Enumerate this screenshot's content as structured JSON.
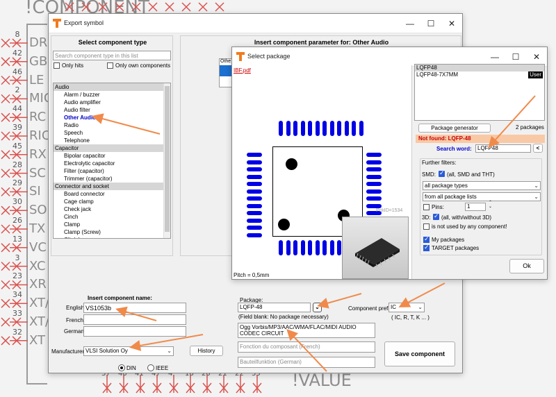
{
  "schematic": {
    "component_label": "!COMPONENT",
    "value_label": "!VALUE",
    "pins": [
      {
        "num": "8",
        "name": "DR"
      },
      {
        "num": "42",
        "name": "GB"
      },
      {
        "num": "46",
        "name": "LE"
      },
      {
        "num": "2",
        "name": "MIC"
      },
      {
        "num": "44",
        "name": "RC"
      },
      {
        "num": "39",
        "name": "RIC"
      },
      {
        "num": "45",
        "name": "RX"
      },
      {
        "num": "28",
        "name": "SC"
      },
      {
        "num": "29",
        "name": "SI"
      },
      {
        "num": "30",
        "name": "SO"
      },
      {
        "num": "26",
        "name": "TX"
      },
      {
        "num": "13",
        "name": "VC"
      },
      {
        "num": "3",
        "name": "XC"
      },
      {
        "num": "23",
        "name": "XR"
      },
      {
        "num": "34",
        "name": "XT/"
      },
      {
        "num": "33",
        "name": "XT/"
      },
      {
        "num": "32",
        "name": "XT"
      }
    ],
    "bottom_pins": [
      "37",
      "40",
      "41",
      "47",
      "4",
      "16",
      "20",
      "21",
      "22",
      "35"
    ]
  },
  "export_window": {
    "title": "Export symbol",
    "select_type_heading": "Select component type",
    "search_placeholder": "Search component type in this list",
    "only_hits_label": "Only hits",
    "only_own_label": "Only own components",
    "insert_param_heading": "Insert component parameter for: Other Audio",
    "param_stub": "Othe",
    "types_list": [
      {
        "label": "Audio",
        "kind": "cat"
      },
      {
        "label": "Alarm / buzzer",
        "kind": "item"
      },
      {
        "label": "Audio amplifier",
        "kind": "item"
      },
      {
        "label": "Audio filter",
        "kind": "item"
      },
      {
        "label": "Other Audio",
        "kind": "sel"
      },
      {
        "label": "Radio",
        "kind": "item"
      },
      {
        "label": "Speech",
        "kind": "item"
      },
      {
        "label": "Telephone",
        "kind": "item"
      },
      {
        "label": "Capacitor",
        "kind": "cat"
      },
      {
        "label": "Bipolar capacitor",
        "kind": "item"
      },
      {
        "label": "Electrolytic capacitor",
        "kind": "item"
      },
      {
        "label": "Filter (capacitor)",
        "kind": "item"
      },
      {
        "label": "Trimmer (capacitor)",
        "kind": "item"
      },
      {
        "label": "Connector and socket",
        "kind": "cat"
      },
      {
        "label": "Board connector",
        "kind": "item"
      },
      {
        "label": "Cage clamp",
        "kind": "item"
      },
      {
        "label": "Check jack",
        "kind": "item"
      },
      {
        "label": "Cinch",
        "kind": "item"
      },
      {
        "label": "Clamp",
        "kind": "item"
      },
      {
        "label": "Clamp (Screw)",
        "kind": "item"
      },
      {
        "label": "Clip/plug",
        "kind": "item"
      }
    ],
    "insert_name_heading": "Insert component name:",
    "english_label": "English",
    "english_value": "VS1053b",
    "french_label": "French",
    "german_label": "German",
    "manufacturer_label": "Manufacturer",
    "manufacturer_value": "VLSI Solution Oy",
    "history_label": "History",
    "din_label": "DIN",
    "ieee_label": "IEEE",
    "package_label": "Package:",
    "package_value": "LQFP-48",
    "package_note": "(Field blank: No package necessary)",
    "prefix_label": "Component prefix:",
    "prefix_value": "IC",
    "prefix_note": "( IC, R, T, K ... )",
    "description_value": "Ogg Vorbis/MP3/AAC/WMA/FLAC/MIDI AUDIO CODEC CIRCUIT",
    "fonction_placeholder": "Fonction du composant (French)",
    "bauteil_placeholder": "Bauteilfunktion (German)",
    "save_label": "Save component"
  },
  "package_window": {
    "title": "Select package",
    "ibf_link": "IBF.pdf",
    "pck_id": "PckID=1534",
    "pitch": "Pitch = 0,5mm",
    "packages": [
      {
        "name": "LQFP48",
        "badge": ""
      },
      {
        "name": "LQFP48-7X7MM",
        "badge": "User"
      }
    ],
    "generator_label": "Package generator",
    "count_label": "2 packages",
    "not_found": "Not found: LQFP-48",
    "search_label": "Search word:",
    "search_value": "LQFP48",
    "back_label": "<",
    "filters_label": "Further filters:",
    "smd_label": "SMD:",
    "smd_value": "(all, SMD and THT)",
    "types_value": "all package types",
    "lists_value": "from all package lists",
    "pins_label": "Pins:",
    "pins_value": "1",
    "threed_label": "3D:",
    "threed_value": "(all, with/without 3D)",
    "unused_label": "is not used by any component!",
    "my_packages_label": "My packages",
    "target_packages_label": "TARGET packages",
    "ok_label": "Ok"
  },
  "colors": {
    "pad_blue": "#0000e6",
    "selected_item": "#0000c8",
    "arrow": "#f08a4b",
    "not_found_bg": "#f9c9a6",
    "link_red": "#cc0000"
  },
  "icons": {
    "app": "target-logo-icon",
    "minimize": "minimize-icon",
    "maximize": "maximize-icon",
    "close": "close-icon",
    "dropdown": "chevron-down-icon"
  }
}
